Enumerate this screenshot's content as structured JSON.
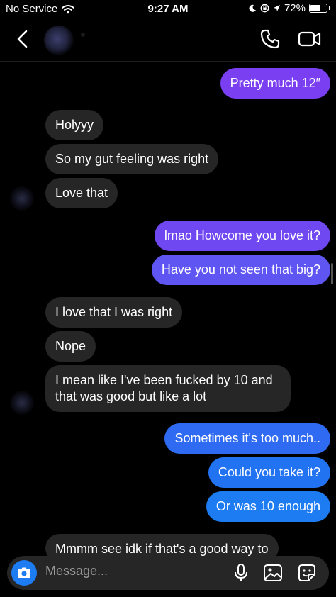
{
  "status_bar": {
    "carrier": "No Service",
    "time": "9:27 AM",
    "battery": "72%",
    "battery_level": 0.72
  },
  "header": {
    "icons": [
      "chevron-left-icon",
      "phone-icon",
      "video-camera-icon"
    ]
  },
  "messages": [
    {
      "from": "me",
      "text": "Pretty much 12″"
    },
    {
      "from": "them",
      "text": "Holyyy"
    },
    {
      "from": "them",
      "text": "So my gut feeling was right"
    },
    {
      "from": "them",
      "text": "Love that"
    },
    {
      "from": "me",
      "text": "lmao Howcome you love it?"
    },
    {
      "from": "me",
      "text": "Have you not seen that big?"
    },
    {
      "from": "them",
      "text": "I love that I was right"
    },
    {
      "from": "them",
      "text": "Nope"
    },
    {
      "from": "them",
      "text": "I mean like I've been fucked by 10 and that was good but like a lot"
    },
    {
      "from": "me",
      "text": "Sometimes it's too much.."
    },
    {
      "from": "me",
      "text": "Could you take it?"
    },
    {
      "from": "me",
      "text": "Or was 10 enough"
    },
    {
      "from": "them",
      "text": "Mmmm see idk if that's a good way to"
    }
  ],
  "composer": {
    "placeholder": "Message...",
    "icons": [
      "camera-icon",
      "microphone-icon",
      "image-icon",
      "sticker-icon"
    ]
  },
  "colors": {
    "incoming_bubble": "#262626",
    "outgoing_purple": "#7b3ff2",
    "outgoing_blue": "#1d7cf2",
    "camera_button": "#1d7cf2"
  }
}
